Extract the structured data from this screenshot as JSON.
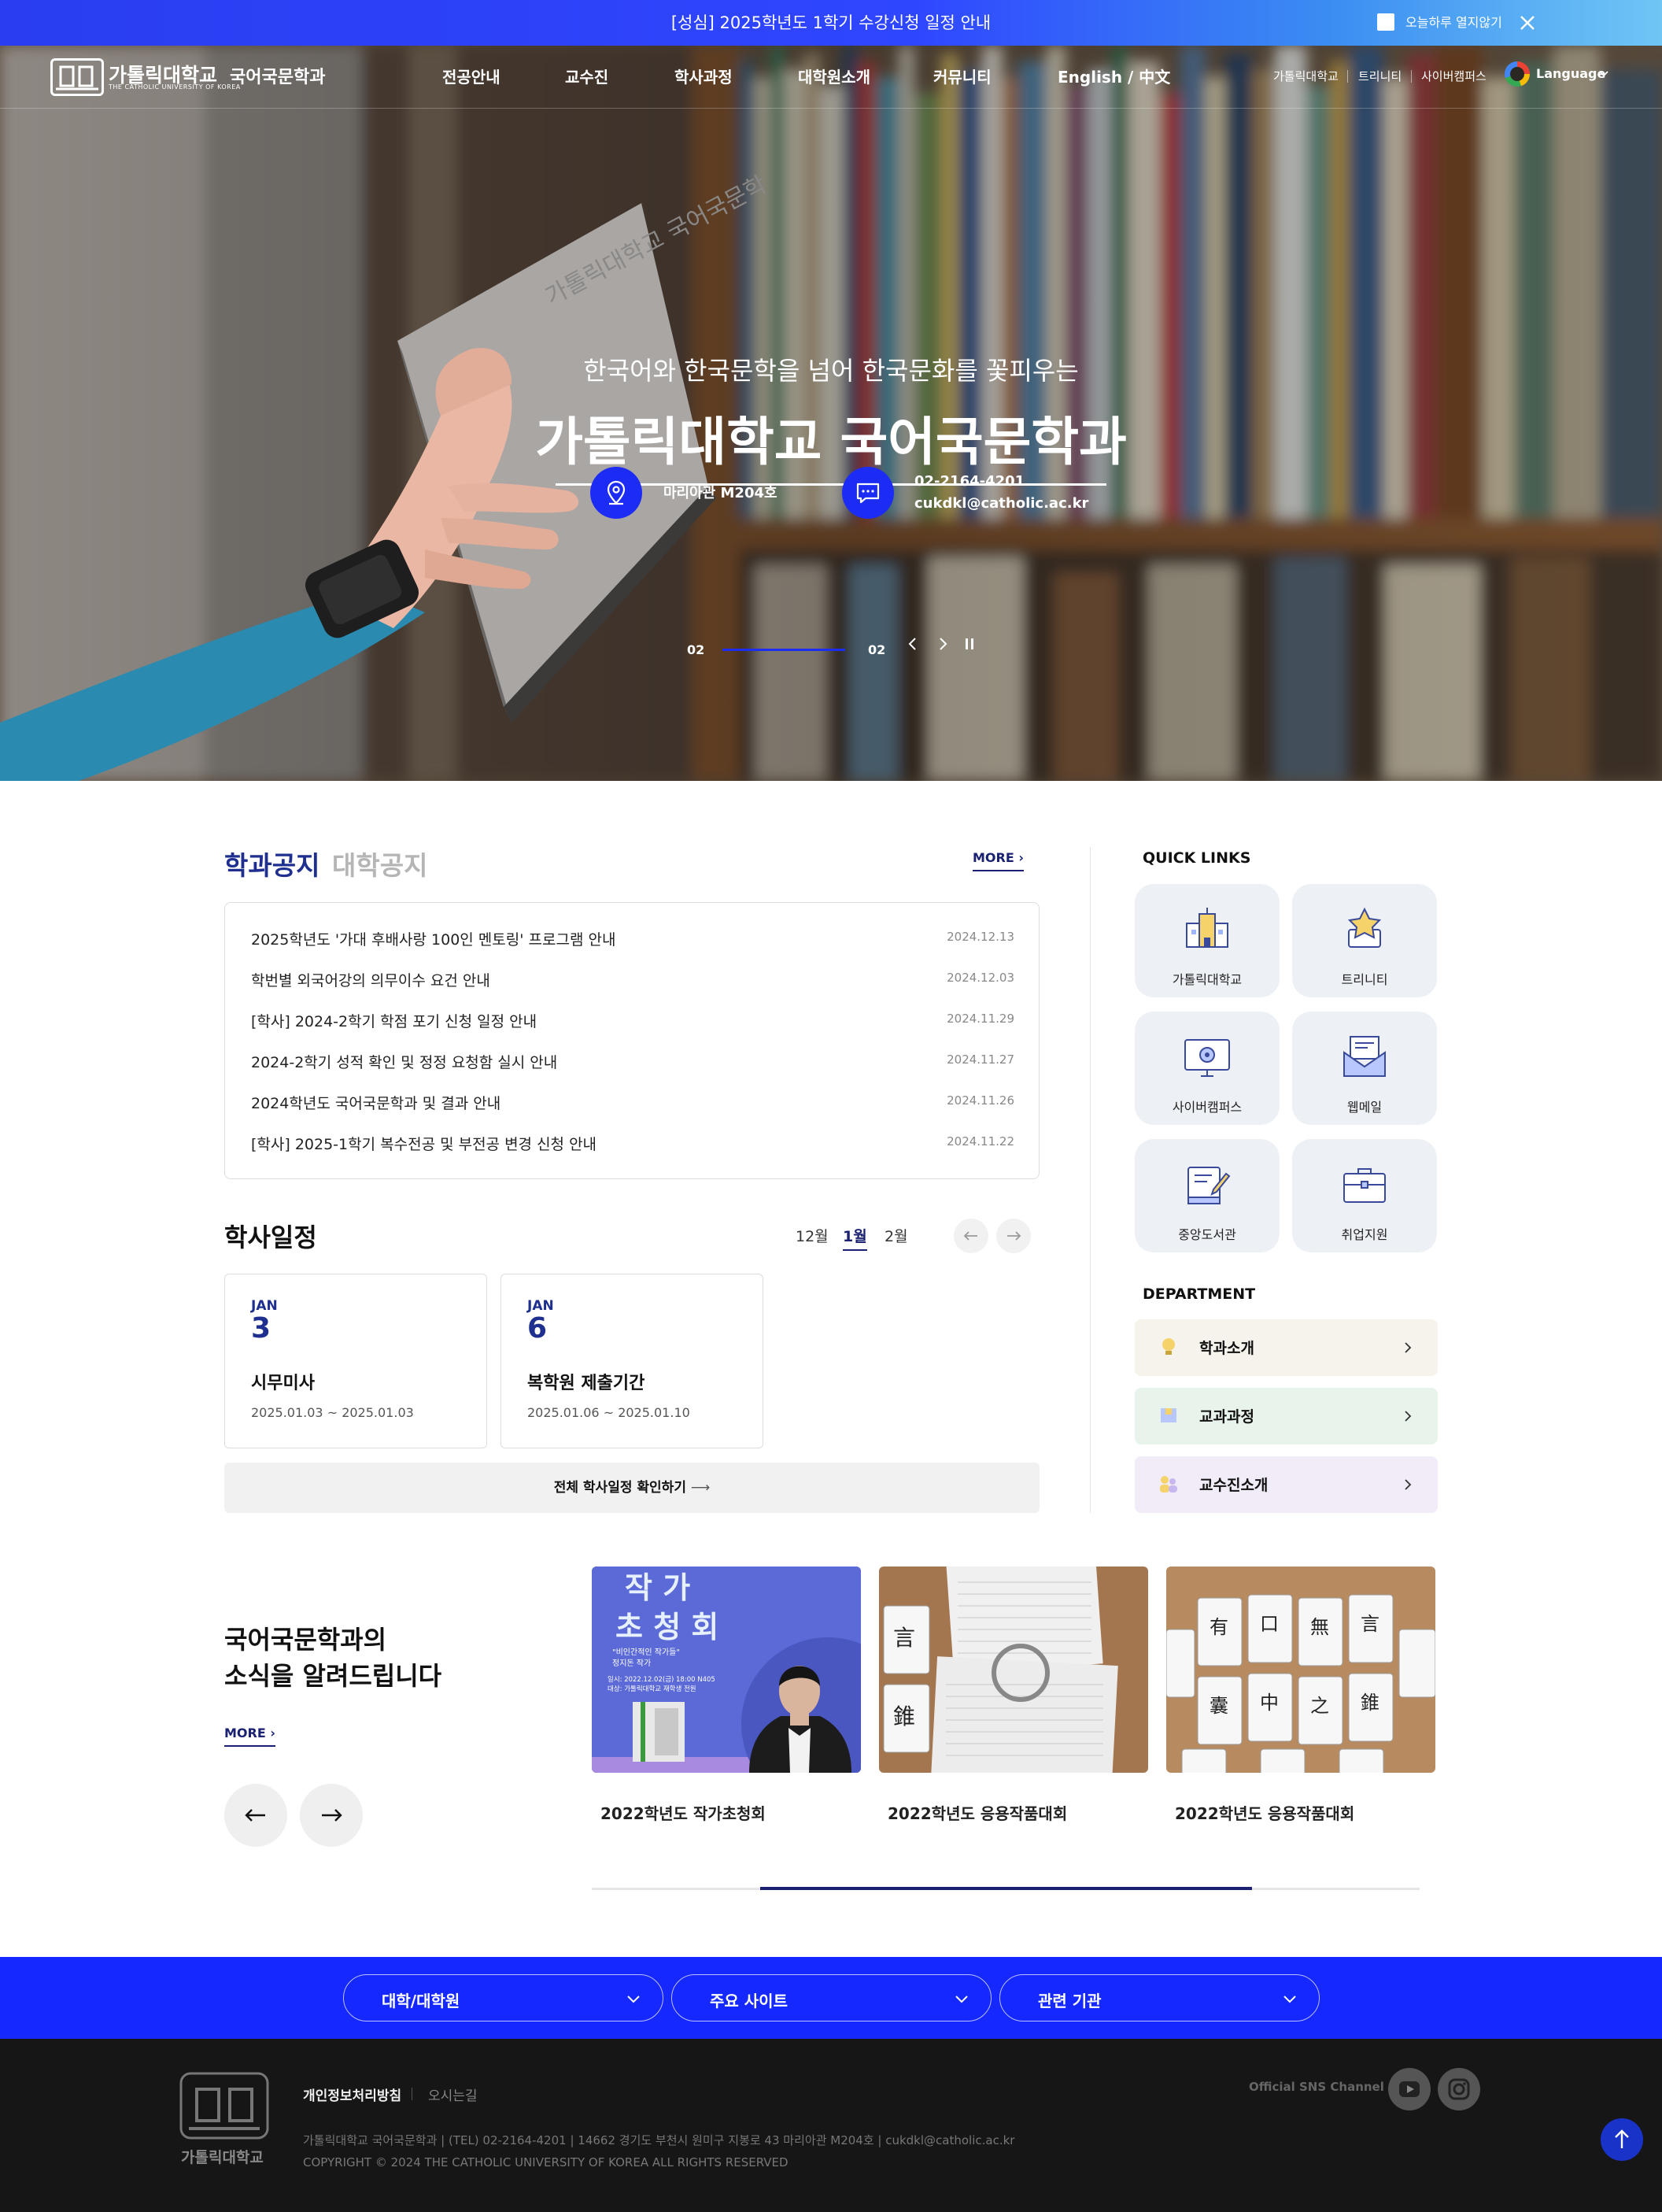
{
  "notice_bar": {
    "message": "[성심] 2025학년도 1학기 수강신청 일정 안내",
    "dismiss_label": "오늘하루 열지않기"
  },
  "header": {
    "logo_text": "가톨릭대학교",
    "logo_sub": "THE CATHOLIC UNIVERSITY OF KOREA",
    "dept_name": "국어국문학과",
    "nav": [
      "전공안내",
      "교수진",
      "학사과정",
      "대학원소개",
      "커뮤니티",
      "English / 中文"
    ],
    "util": [
      "가톨릭대학교",
      "트리니티",
      "사이버캠퍼스"
    ],
    "language_label": "Language"
  },
  "hero": {
    "subtitle": "한국어와 한국문학을 넘어 한국문화를 꽃피우는",
    "title": "가톨릭대학교 국어국문학과",
    "location": "마리아관 M204호",
    "phone": "02-2164-4201",
    "email": "cukdkl@catholic.ac.kr",
    "slide_current": "02",
    "slide_total": "02",
    "slide_progress": 1.0,
    "book_title": "가톨릭대학교 국어국문학"
  },
  "notices": {
    "tab_active": "학과공지",
    "tab_inactive": "대학공지",
    "more_label": "MORE",
    "items": [
      {
        "title": "2025학년도 '가대 후배사랑 100인 멘토링' 프로그램 안내",
        "date": "2024.12.13"
      },
      {
        "title": "학번별 외국어강의 의무이수 요건 안내",
        "date": "2024.12.03"
      },
      {
        "title": "[학사] 2024-2학기 학점 포기 신청 일정 안내",
        "date": "2024.11.29"
      },
      {
        "title": "2024-2학기 성적 확인 및 정정 요청함 실시 안내",
        "date": "2024.11.27"
      },
      {
        "title": "2024학년도 국어국문학과 및 결과 안내",
        "date": "2024.11.26"
      },
      {
        "title": "[학사] 2025-1학기 복수전공 및 부전공 변경 신청 안내",
        "date": "2024.11.22"
      }
    ]
  },
  "schedule": {
    "heading": "학사일정",
    "months": [
      "12월",
      "1월",
      "2월"
    ],
    "active_month": "1월",
    "events": [
      {
        "month": "JAN",
        "day": "3",
        "title": "시무미사",
        "range": "2025.01.03 ~ 2025.01.03"
      },
      {
        "month": "JAN",
        "day": "6",
        "title": "복학원 제출기간",
        "range": "2025.01.06 ~ 2025.01.10"
      }
    ],
    "all_label": "전체 학사일정 확인하기"
  },
  "quick_links": {
    "heading": "QUICK LINKS",
    "items": [
      "가톨릭대학교",
      "트리니티",
      "사이버캠퍼스",
      "웹메일",
      "중앙도서관",
      "취업지원"
    ]
  },
  "department": {
    "heading": "DEPARTMENT",
    "items": [
      {
        "label": "학과소개",
        "bg": "#f5f3ec"
      },
      {
        "label": "교과과정",
        "bg": "#e8f3ec"
      },
      {
        "label": "교수진소개",
        "bg": "#f1ecf7"
      }
    ]
  },
  "news": {
    "heading_line1": "국어국문학과의",
    "heading_line2": "소식을 알려드립니다",
    "more_label": "MORE",
    "poster": {
      "title1": "작 가",
      "title2": "초 청 회",
      "line1": "\"비인간적인 작가들\"",
      "line2": "정지돈 작가",
      "line3": "일시: 2022.12.02(금) 18:00 N405",
      "line4": "대상: 가톨릭대학교 재학생 전원"
    },
    "cards": [
      {
        "caption": "2022학년도 작가초청회"
      },
      {
        "caption": "2022학년도 응용작품대회"
      },
      {
        "caption": "2022학년도 응용작품대회"
      }
    ],
    "card_chars_a": [
      "言",
      "錐"
    ],
    "card_chars_b": [
      "有",
      "口",
      "無",
      "言",
      "囊",
      "中",
      "之",
      "錐"
    ]
  },
  "footer": {
    "selects": [
      "대학/대학원",
      "주요 사이트",
      "관련 기관"
    ],
    "privacy": "개인정보처리방침",
    "directions": "오시는길",
    "sns_label": "Official SNS Channel",
    "address": "가톨릭대학교 국어국문학과  |  (TEL) 02-2164-4201  |  14662 경기도 부천시 원미구 지봉로 43 마리아관 M204호  |  cukdkl@catholic.ac.kr",
    "copyright": "COPYRIGHT © 2024 THE CATHOLIC UNIVERSITY OF KOREA ALL RIGHTS RESERVED",
    "logo_text": "가톨릭대학교"
  },
  "colors": {
    "brand_blue": "#1428ff",
    "navy": "#1a2170",
    "hero_circle": "#1d2cf5"
  }
}
